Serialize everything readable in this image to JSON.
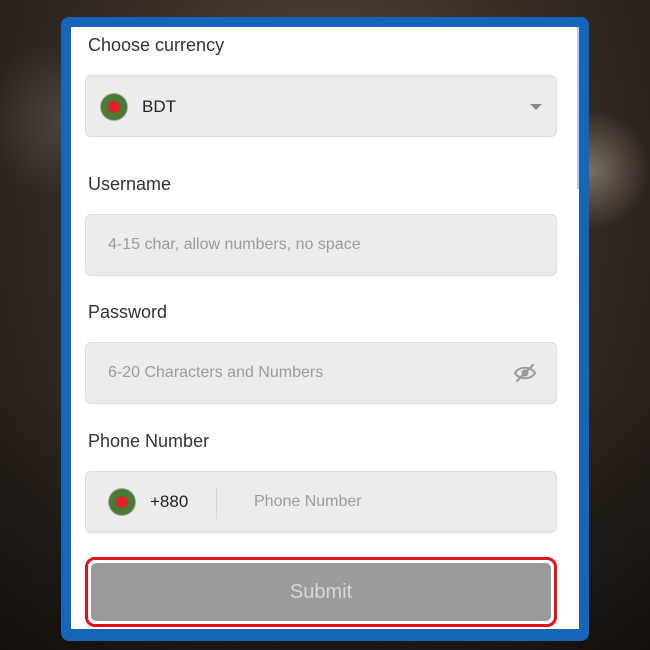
{
  "form": {
    "currency": {
      "label": "Choose currency",
      "selected": "BDT"
    },
    "username": {
      "label": "Username",
      "placeholder": "4-15 char, allow numbers, no space"
    },
    "password": {
      "label": "Password",
      "placeholder": "6-20 Characters and Numbers"
    },
    "phone": {
      "label": "Phone Number",
      "country_code": "+880",
      "placeholder": "Phone Number"
    },
    "submit_label": "Submit"
  },
  "colors": {
    "frame": "#1565b8",
    "flag_green": "#4a7a33",
    "flag_red": "#e0202a",
    "highlight": "#e3111b",
    "submit_bg": "#9b9b9b"
  },
  "icons": {
    "currency_flag": "bangladesh-flag-icon",
    "currency_caret": "chevron-down-icon",
    "password_toggle": "eye-slash-icon",
    "phone_flag": "bangladesh-flag-icon"
  }
}
